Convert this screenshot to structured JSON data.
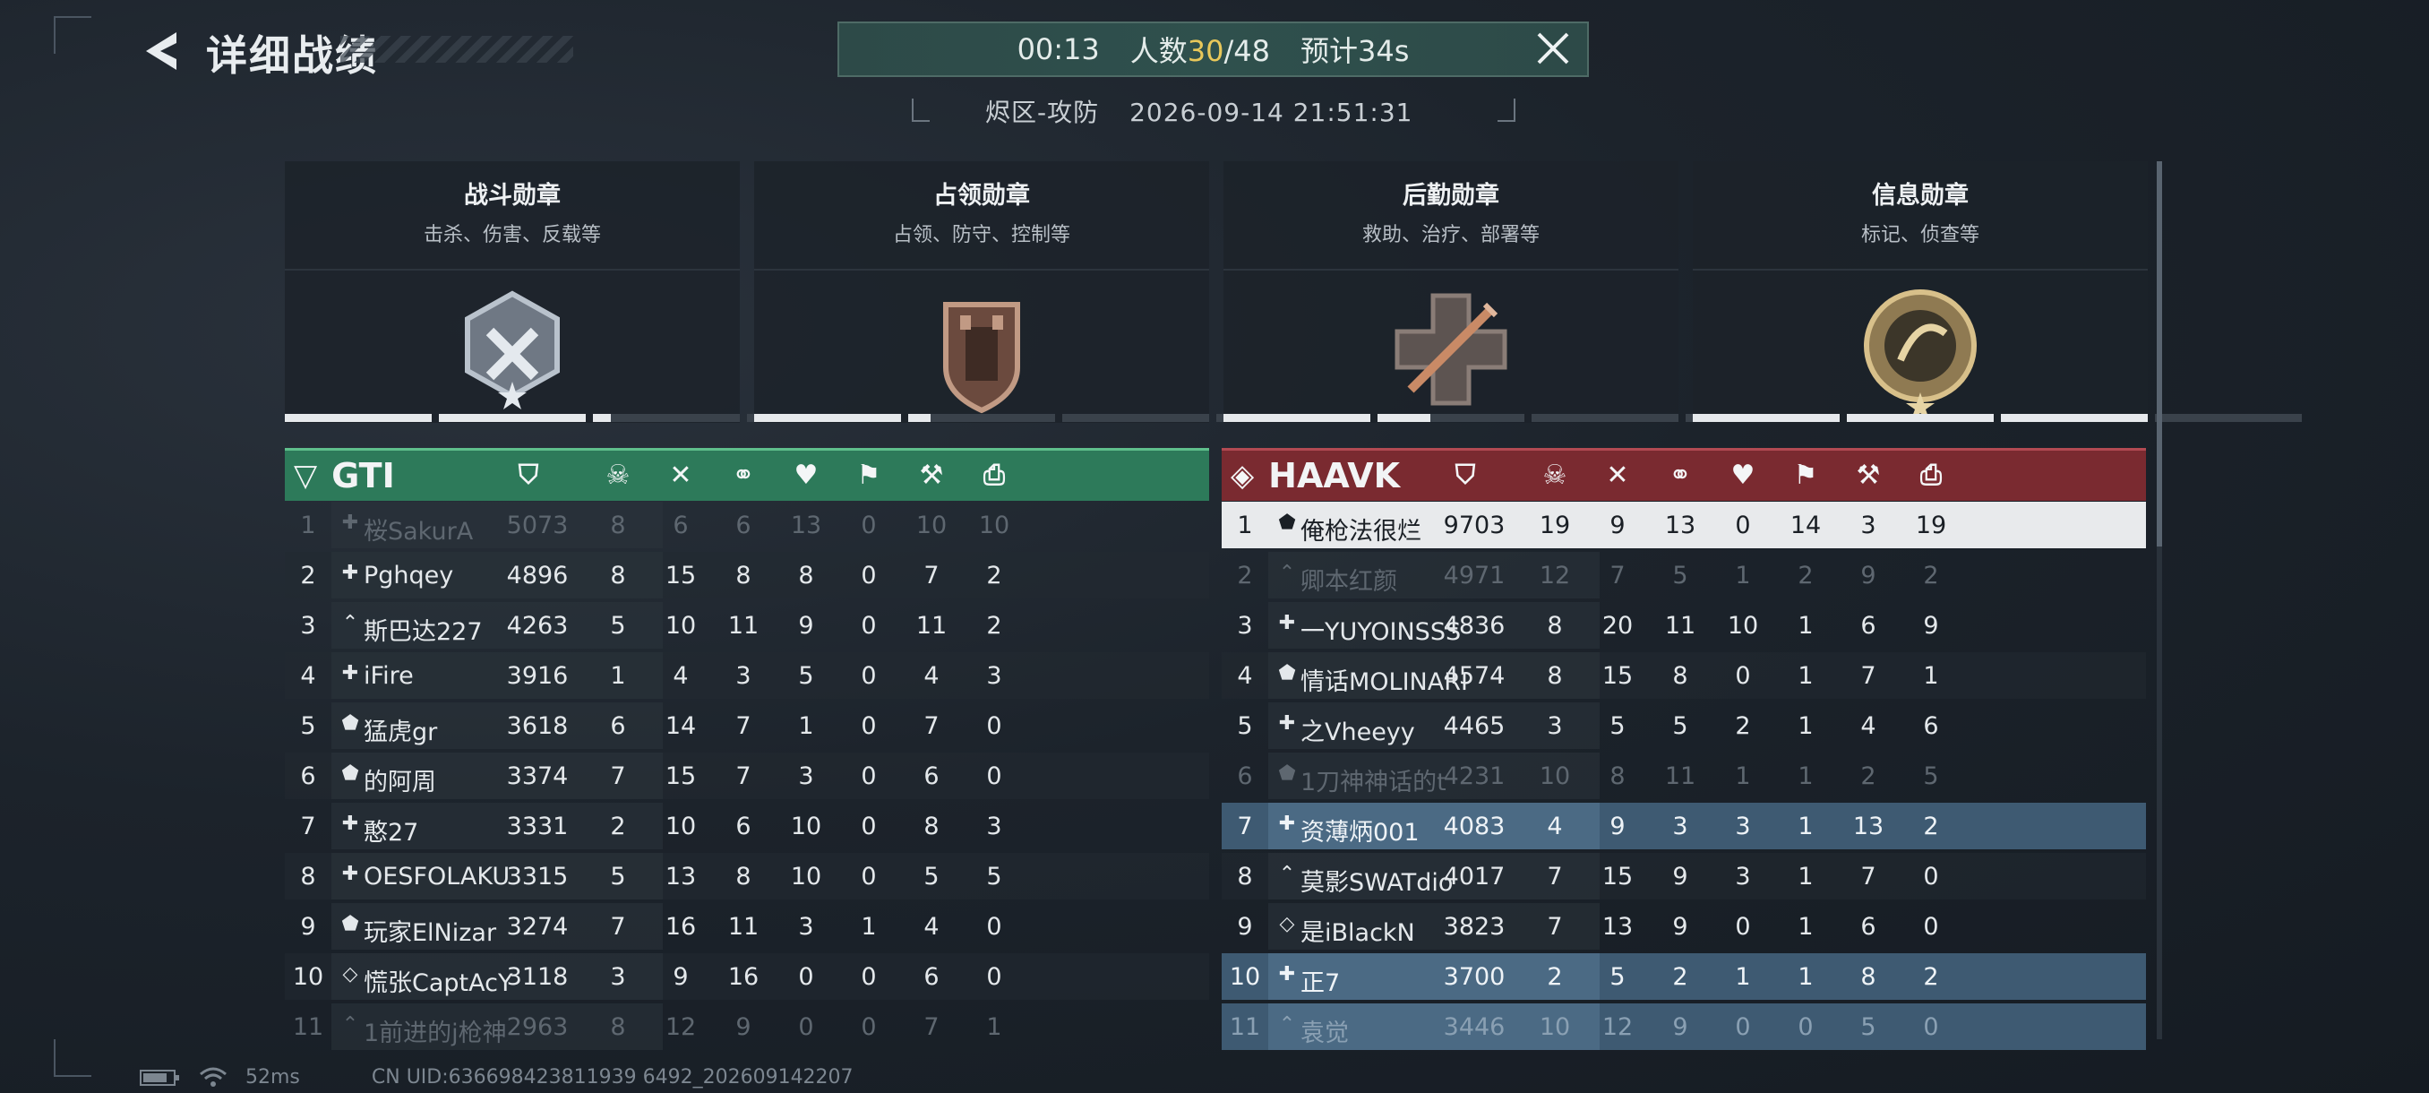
{
  "header": {
    "title": "详细战绩",
    "timer": "00:13",
    "players_label": "人数",
    "players_current": "30",
    "players_total": "/48",
    "eta": "预计34s",
    "mode": "烬区-攻防",
    "datetime": "2026-09-14 21:51:31"
  },
  "medals": [
    {
      "title": "战斗勋章",
      "desc": "击杀、伤害、反载等",
      "icon": "combat-medal-icon",
      "progress": [
        1,
        1,
        0.12,
        0
      ]
    },
    {
      "title": "占领勋章",
      "desc": "占领、防守、控制等",
      "icon": "capture-medal-icon",
      "progress": [
        1,
        0.15,
        0,
        0
      ]
    },
    {
      "title": "后勤勋章",
      "desc": "救助、治疗、部署等",
      "icon": "logistics-medal-icon",
      "progress": [
        1,
        0.36,
        0,
        0
      ]
    },
    {
      "title": "信息勋章",
      "desc": "标记、侦查等",
      "icon": "intel-medal-icon",
      "progress": [
        1,
        1,
        1,
        0
      ]
    }
  ],
  "teams": {
    "left": {
      "name": "GTI",
      "color": "#2d7a5a",
      "column_icons": [
        "score-icon",
        "kill-skull-icon",
        "death-cross-icon",
        "assist-handshake-icon",
        "revive-heart-icon",
        "capture-icon",
        "build-icon",
        "intel-icon"
      ],
      "rows": [
        {
          "rank": "1",
          "role": "medic",
          "name": "桜SakurA",
          "stats": [
            "5073",
            "8",
            "6",
            "6",
            "13",
            "0",
            "10",
            "10"
          ],
          "state": "dim"
        },
        {
          "rank": "2",
          "role": "medic",
          "name": "Pghqey",
          "stats": [
            "4896",
            "8",
            "15",
            "8",
            "8",
            "0",
            "7",
            "2"
          ],
          "state": "norm"
        },
        {
          "rank": "3",
          "role": "assault",
          "name": "斯巴达227",
          "stats": [
            "4263",
            "5",
            "10",
            "11",
            "9",
            "0",
            "11",
            "2"
          ],
          "state": "norm"
        },
        {
          "rank": "4",
          "role": "medic",
          "name": "iFire",
          "stats": [
            "3916",
            "1",
            "4",
            "3",
            "5",
            "0",
            "4",
            "3"
          ],
          "state": "norm"
        },
        {
          "rank": "5",
          "role": "engineer",
          "name": "猛虎gr",
          "stats": [
            "3618",
            "6",
            "14",
            "7",
            "1",
            "0",
            "7",
            "0"
          ],
          "state": "norm"
        },
        {
          "rank": "6",
          "role": "engineer",
          "name": "的阿周",
          "stats": [
            "3374",
            "7",
            "15",
            "7",
            "3",
            "0",
            "6",
            "0"
          ],
          "state": "norm"
        },
        {
          "rank": "7",
          "role": "medic",
          "name": "憨27",
          "stats": [
            "3331",
            "2",
            "10",
            "6",
            "10",
            "0",
            "8",
            "3"
          ],
          "state": "norm"
        },
        {
          "rank": "8",
          "role": "medic",
          "name": "OESFOLAKU",
          "stats": [
            "3315",
            "5",
            "13",
            "8",
            "10",
            "0",
            "5",
            "5"
          ],
          "state": "norm"
        },
        {
          "rank": "9",
          "role": "engineer",
          "name": "玩家ElNizar",
          "stats": [
            "3274",
            "7",
            "16",
            "11",
            "3",
            "1",
            "4",
            "0"
          ],
          "state": "norm"
        },
        {
          "rank": "10",
          "role": "recon",
          "name": "慌张CaptAcY",
          "stats": [
            "3118",
            "3",
            "9",
            "16",
            "0",
            "0",
            "6",
            "0"
          ],
          "state": "norm"
        },
        {
          "rank": "11",
          "role": "assault",
          "name": "1前进的j枪神",
          "stats": [
            "2963",
            "8",
            "12",
            "9",
            "0",
            "0",
            "7",
            "1"
          ],
          "state": "dim"
        }
      ]
    },
    "right": {
      "name": "HAAVK",
      "color": "#7a2a30",
      "column_icons": [
        "score-icon",
        "kill-skull-icon",
        "death-cross-icon",
        "assist-handshake-icon",
        "revive-heart-icon",
        "capture-icon",
        "build-icon",
        "intel-icon"
      ],
      "rows": [
        {
          "rank": "1",
          "role": "engineer",
          "name": "俺枪法很烂",
          "stats": [
            "9703",
            "19",
            "9",
            "13",
            "0",
            "14",
            "3",
            "19"
          ],
          "state": "me"
        },
        {
          "rank": "2",
          "role": "assault",
          "name": "卿本红颜",
          "stats": [
            "4971",
            "12",
            "7",
            "5",
            "1",
            "2",
            "9",
            "2"
          ],
          "state": "dim"
        },
        {
          "rank": "3",
          "role": "medic",
          "name": "一YUYOINSSS",
          "stats": [
            "4836",
            "8",
            "20",
            "11",
            "10",
            "1",
            "6",
            "9"
          ],
          "state": "norm"
        },
        {
          "rank": "4",
          "role": "engineer",
          "name": "情话MOLINARI",
          "stats": [
            "4574",
            "8",
            "15",
            "8",
            "0",
            "1",
            "7",
            "1"
          ],
          "state": "norm"
        },
        {
          "rank": "5",
          "role": "medic",
          "name": "之Vheeyy",
          "stats": [
            "4465",
            "3",
            "5",
            "5",
            "2",
            "1",
            "4",
            "6"
          ],
          "state": "norm"
        },
        {
          "rank": "6",
          "role": "engineer",
          "name": "1刀神神话的t",
          "stats": [
            "4231",
            "10",
            "8",
            "11",
            "1",
            "1",
            "2",
            "5"
          ],
          "state": "dim"
        },
        {
          "rank": "7",
          "role": "medic",
          "name": "资薄炳001",
          "stats": [
            "4083",
            "4",
            "9",
            "3",
            "3",
            "1",
            "13",
            "2"
          ],
          "state": "mate"
        },
        {
          "rank": "8",
          "role": "assault",
          "name": "莫影SWATdio",
          "stats": [
            "4017",
            "7",
            "15",
            "9",
            "3",
            "1",
            "7",
            "0"
          ],
          "state": "norm"
        },
        {
          "rank": "9",
          "role": "recon",
          "name": "是iBlackN",
          "stats": [
            "3823",
            "7",
            "13",
            "9",
            "0",
            "1",
            "6",
            "0"
          ],
          "state": "norm"
        },
        {
          "rank": "10",
          "role": "medic",
          "name": "正7",
          "stats": [
            "3700",
            "2",
            "5",
            "2",
            "1",
            "1",
            "8",
            "2"
          ],
          "state": "mate"
        },
        {
          "rank": "11",
          "role": "assault",
          "name": "袁觉",
          "stats": [
            "3446",
            "10",
            "12",
            "9",
            "0",
            "0",
            "5",
            "0"
          ],
          "state": "mate dim"
        }
      ]
    }
  },
  "footer": {
    "ping": "52ms",
    "uid": "CN UID:636698423811939 6492_202609142207"
  },
  "colors": {
    "highlight": "#e9c85a",
    "team_left": "#2d7a5a",
    "team_right": "#7a2a30",
    "self_row": "#e8eaec",
    "mate_row": "#3e5a72"
  }
}
